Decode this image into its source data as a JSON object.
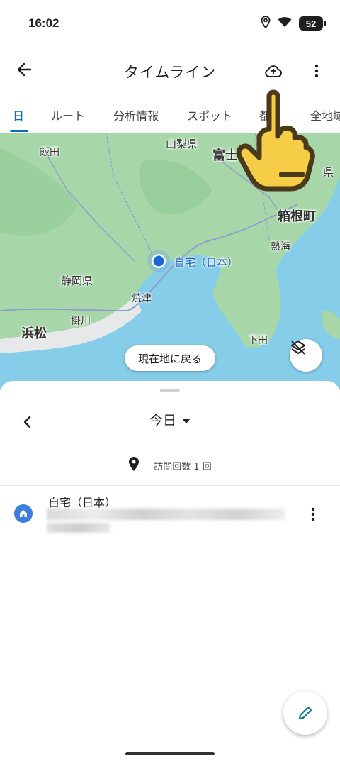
{
  "status_bar": {
    "time": "16:02",
    "battery": "52"
  },
  "app_bar": {
    "title": "タイムライン"
  },
  "tabs": [
    {
      "label": "日",
      "active": true
    },
    {
      "label": "ルート",
      "active": false
    },
    {
      "label": "分析情報",
      "active": false
    },
    {
      "label": "スポット",
      "active": false
    },
    {
      "label": "都",
      "active": false
    },
    {
      "label": "全地域",
      "active": false
    }
  ],
  "map": {
    "labels": {
      "iida": "飯田",
      "yamanashi": "山梨県",
      "fuji": "富士",
      "ken": "県",
      "hakone": "箱根町",
      "atami": "熱海",
      "home_marker": "自宅（日本）",
      "shizuoka": "静岡県",
      "yaizu": "焼津",
      "kakegawa": "掛川",
      "hamamatsu": "浜松",
      "shimoda": "下田"
    },
    "return_button": "現在地に戻る"
  },
  "sheet": {
    "date_label": "今日",
    "visits_text": "訪問回数 1 回",
    "place": {
      "title": "自宅（日本）"
    }
  },
  "colors": {
    "accent": "#0b6bcb",
    "land": "#a7d7a9",
    "water": "#86cdea",
    "home_badge": "#3c7ddd",
    "fab_icon": "#137a8a",
    "hand_fill": "#f5cd47"
  }
}
